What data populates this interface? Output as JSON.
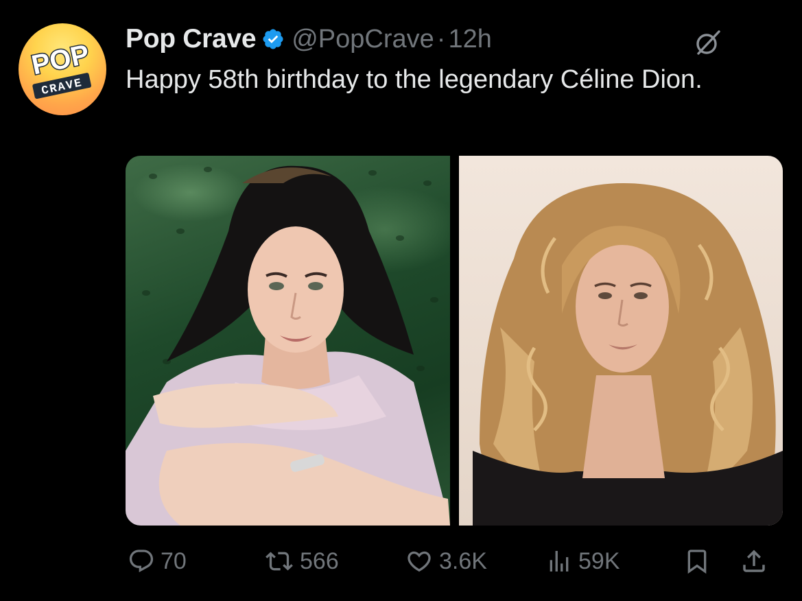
{
  "tweet": {
    "display_name": "Pop Crave",
    "handle": "@PopCrave",
    "separator": "·",
    "time": "12h",
    "text": "Happy 58th birthday to the legendary Céline Dion.",
    "avatar": {
      "logo_top": "POP",
      "logo_bottom": "CRAVE"
    }
  },
  "actions": {
    "replies": "70",
    "reposts": "566",
    "likes": "3.6K",
    "views": "59K"
  },
  "icons": {
    "verified": "verified-badge-icon",
    "grok": "grok-icon",
    "reply": "reply-icon",
    "repost": "repost-icon",
    "like": "heart-icon",
    "views": "views-bar-chart-icon",
    "bookmark": "bookmark-icon",
    "share": "share-icon"
  },
  "colors": {
    "background": "#000000",
    "text": "#e7e9ea",
    "secondary": "#71767b",
    "verified": "#1d9bf0"
  }
}
